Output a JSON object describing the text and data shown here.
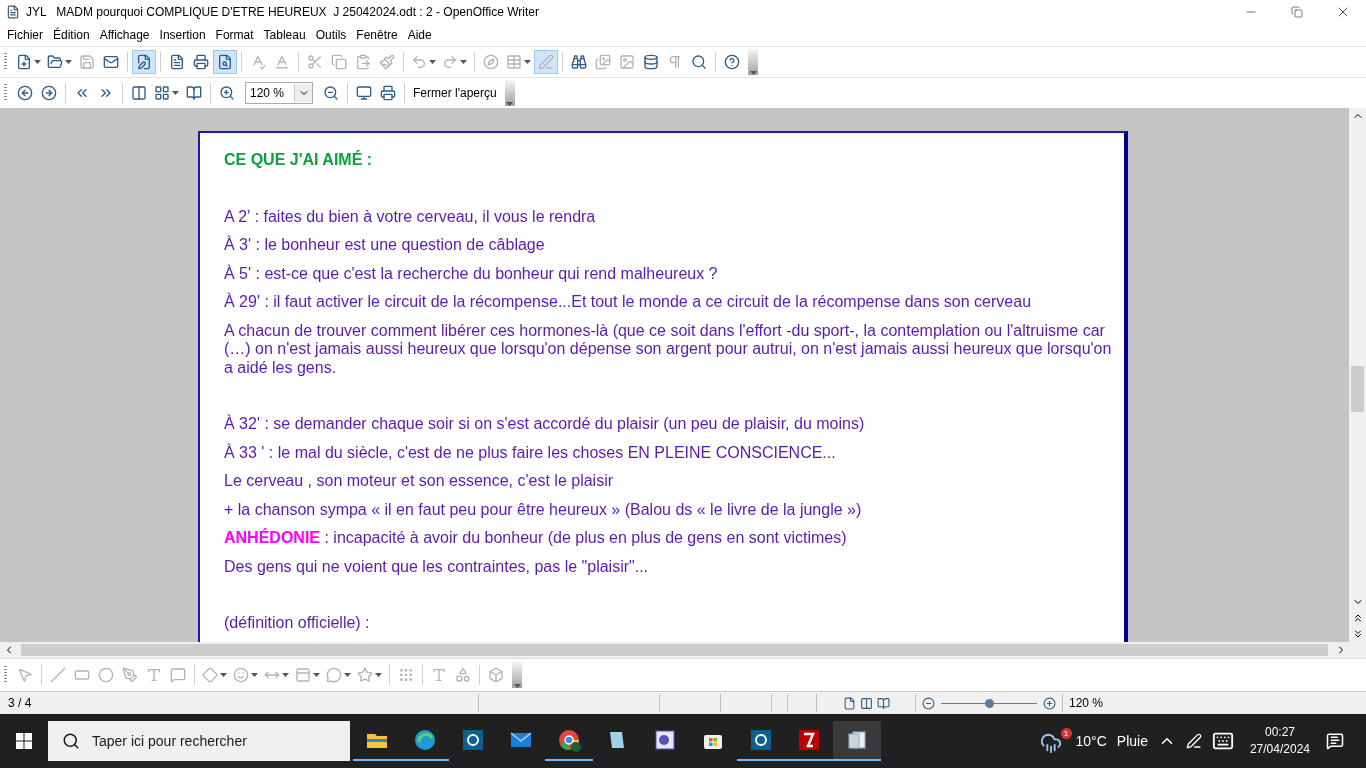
{
  "window": {
    "title": "JYL   MADM pourquoi COMPLIQUE D'ETRE HEUREUX  J 25042024.odt : 2 - OpenOffice Writer"
  },
  "menu": [
    {
      "label": "Fichier",
      "selected": false
    },
    {
      "label": "Édition",
      "selected": false
    },
    {
      "label": "Affichage",
      "selected": false
    },
    {
      "label": "Insertion",
      "selected": false
    },
    {
      "label": "Format",
      "selected": false
    },
    {
      "label": "Tableau",
      "selected": false
    },
    {
      "label": "Outils",
      "selected": false
    },
    {
      "label": "Fenêtre",
      "selected": false
    },
    {
      "label": "Aide",
      "selected": false
    }
  ],
  "standard_toolbar": [
    {
      "kind": "new",
      "disabled": false,
      "pressed": false,
      "dropdown": true
    },
    {
      "kind": "open",
      "disabled": false,
      "pressed": false,
      "dropdown": true
    },
    {
      "kind": "save",
      "disabled": true,
      "pressed": false,
      "dropdown": false
    },
    {
      "kind": "email",
      "disabled": false,
      "pressed": false,
      "dropdown": false
    },
    {
      "kind": "separator"
    },
    {
      "kind": "edit",
      "disabled": false,
      "pressed": true,
      "dropdown": false
    },
    {
      "kind": "separator"
    },
    {
      "kind": "pdf",
      "disabled": false,
      "pressed": false,
      "dropdown": false
    },
    {
      "kind": "print",
      "disabled": false,
      "pressed": false,
      "dropdown": false
    },
    {
      "kind": "preview",
      "disabled": false,
      "pressed": true,
      "dropdown": false
    },
    {
      "kind": "separator"
    },
    {
      "kind": "spellcheck",
      "disabled": true,
      "pressed": false,
      "dropdown": false
    },
    {
      "kind": "autospell",
      "disabled": true,
      "pressed": false,
      "dropdown": false
    },
    {
      "kind": "separator"
    },
    {
      "kind": "cut",
      "disabled": true,
      "pressed": false,
      "dropdown": false
    },
    {
      "kind": "copy",
      "disabled": true,
      "pressed": false,
      "dropdown": false
    },
    {
      "kind": "paste",
      "disabled": true,
      "pressed": false,
      "dropdown": false
    },
    {
      "kind": "brush",
      "disabled": true,
      "pressed": false,
      "dropdown": false
    },
    {
      "kind": "separator"
    },
    {
      "kind": "undo",
      "disabled": true,
      "pressed": false,
      "dropdown": true
    },
    {
      "kind": "redo",
      "disabled": true,
      "pressed": false,
      "dropdown": true
    },
    {
      "kind": "separator"
    },
    {
      "kind": "navigator",
      "disabled": true,
      "pressed": false,
      "dropdown": false
    },
    {
      "kind": "table",
      "disabled": true,
      "pressed": false,
      "dropdown": true
    },
    {
      "kind": "draw",
      "disabled": true,
      "pressed": true,
      "dropdown": false
    },
    {
      "kind": "separator"
    },
    {
      "kind": "find",
      "disabled": false,
      "pressed": false,
      "dropdown": false
    },
    {
      "kind": "gallery",
      "disabled": true,
      "pressed": false,
      "dropdown": false
    },
    {
      "kind": "image",
      "disabled": true,
      "pressed": false,
      "dropdown": false
    },
    {
      "kind": "database",
      "disabled": false,
      "pressed": false,
      "dropdown": false
    },
    {
      "kind": "pilcrow",
      "disabled": true,
      "pressed": false,
      "dropdown": false
    },
    {
      "kind": "zoom",
      "disabled": false,
      "pressed": false,
      "dropdown": false
    },
    {
      "kind": "separator"
    },
    {
      "kind": "help",
      "disabled": false,
      "pressed": false,
      "dropdown": false
    }
  ],
  "preview_toolbar": {
    "items": [
      {
        "kind": "prev",
        "disabled": false,
        "pressed": false,
        "dropdown": false
      },
      {
        "kind": "next",
        "disabled": false,
        "pressed": false,
        "dropdown": false
      },
      {
        "kind": "separator"
      },
      {
        "kind": "first",
        "disabled": false,
        "pressed": false,
        "dropdown": false
      },
      {
        "kind": "last",
        "disabled": false,
        "pressed": false,
        "dropdown": false
      },
      {
        "kind": "separator"
      },
      {
        "kind": "twopage",
        "disabled": false,
        "pressed": false,
        "dropdown": false
      },
      {
        "kind": "multipage",
        "disabled": false,
        "pressed": false,
        "dropdown": true
      },
      {
        "kind": "book",
        "disabled": false,
        "pressed": false,
        "dropdown": false
      },
      {
        "kind": "separator"
      },
      {
        "kind": "zoomin",
        "disabled": false,
        "pressed": false,
        "dropdown": false
      },
      {
        "kind": "zoombox"
      },
      {
        "kind": "zoomout",
        "disabled": false,
        "pressed": false,
        "dropdown": false
      },
      {
        "kind": "separator"
      },
      {
        "kind": "fullscreen",
        "disabled": false,
        "pressed": false,
        "dropdown": false
      },
      {
        "kind": "printoptions",
        "disabled": false,
        "pressed": false,
        "dropdown": false
      },
      {
        "kind": "separator"
      },
      {
        "kind": "close"
      }
    ],
    "zoom_value": "120 %",
    "close_label": "Fermer l'aperçu"
  },
  "document": [
    {
      "paragraphs": [
        {
          "kind": "heading",
          "text": "CE QUE J'AI AIMÉ :"
        }
      ]
    },
    {
      "paragraphs": [
        {
          "kind": "body",
          "text": "A 2' : faites du bien à votre cerveau, il vous le rendra"
        },
        {
          "kind": "body",
          "text": "À 3' : le bonheur est une question de câblage"
        },
        {
          "kind": "body",
          "text": "À 5' : est-ce que c'est la recherche du bonheur qui rend malheureux ?"
        },
        {
          "kind": "body",
          "text": "À 29' : il faut activer le circuit de la récompense...Et tout le monde a ce  circuit de la récompense dans son cerveau"
        },
        {
          "kind": "body",
          "text": "A chacun  de trouver comment libérer ces hormones-là (que ce soit dans l'effort -du sport-, la contemplation ou l'altruisme car (…)  on n'est jamais aussi heureux que lorsqu'on dépense son argent pour autrui, on n'est jamais aussi heureux que lorsqu'on a aidé les gens."
        }
      ]
    },
    {
      "paragraphs": [
        {
          "kind": "body",
          "text": "À 32' : se demander chaque soir si on s'est accordé du plaisir (un peu de plaisir, du moins)"
        },
        {
          "kind": "body",
          "text": "À 33 ' : le mal du siècle, c'est de ne plus faire les choses EN PLEINE CONSCIENCE..."
        },
        {
          "kind": "body",
          "text": "Le cerveau , son moteur et son essence, c'est le plaisir"
        },
        {
          "kind": "body",
          "text": "+ la chanson sympa « il en faut peu pour être heureux »  (Balou ds « le livre de la jungle »)"
        },
        {
          "kind": "term",
          "term": "ANHÉDONIE",
          "text": " : incapacité à avoir du bonheur (de plus en plus de gens en sont victimes)"
        },
        {
          "kind": "body",
          "text": "Des gens qui ne voient que les contraintes, pas le \"plaisir\"..."
        }
      ]
    },
    {
      "paragraphs": [
        {
          "kind": "body",
          "text": "(définition officielle) :"
        }
      ]
    }
  ],
  "drawing_toolbar": [
    {
      "kind": "select",
      "disabled": true,
      "dropdown": false
    },
    {
      "kind": "separator"
    },
    {
      "kind": "line",
      "disabled": true,
      "dropdown": false
    },
    {
      "kind": "rect",
      "disabled": true,
      "dropdown": false
    },
    {
      "kind": "ellipse",
      "disabled": true,
      "dropdown": false
    },
    {
      "kind": "freeform",
      "disabled": true,
      "dropdown": false
    },
    {
      "kind": "text",
      "disabled": true,
      "dropdown": false
    },
    {
      "kind": "callout",
      "disabled": true,
      "dropdown": false
    },
    {
      "kind": "separator"
    },
    {
      "kind": "diamond",
      "disabled": true,
      "dropdown": true
    },
    {
      "kind": "smiley",
      "disabled": true,
      "dropdown": true
    },
    {
      "kind": "arrows",
      "disabled": true,
      "dropdown": true
    },
    {
      "kind": "flowchart",
      "disabled": true,
      "dropdown": true
    },
    {
      "kind": "bubble",
      "disabled": true,
      "dropdown": true
    },
    {
      "kind": "star",
      "disabled": true,
      "dropdown": true
    },
    {
      "kind": "separator"
    },
    {
      "kind": "points",
      "disabled": true,
      "dropdown": false
    },
    {
      "kind": "separator"
    },
    {
      "kind": "fontwork",
      "disabled": true,
      "dropdown": false
    },
    {
      "kind": "extrusion",
      "disabled": true,
      "dropdown": false
    },
    {
      "kind": "separator"
    },
    {
      "kind": "wrap",
      "disabled": true,
      "dropdown": false
    }
  ],
  "status_bar": {
    "page": "3 / 4",
    "zoom_slider": {
      "level": 0.5
    },
    "zoom": "120 %"
  },
  "taskbar": {
    "search_placeholder": "Taper ici pour rechercher",
    "apps": [
      {
        "kind": "explorer",
        "running": true,
        "selected": false
      },
      {
        "kind": "edge",
        "running": true,
        "selected": false
      },
      {
        "kind": "bluebox",
        "running": false,
        "selected": false
      },
      {
        "kind": "mail",
        "running": false,
        "selected": false
      },
      {
        "kind": "chrome",
        "running": true,
        "selected": false
      },
      {
        "kind": "notepad",
        "running": false,
        "selected": false
      },
      {
        "kind": "purplebox",
        "running": false,
        "selected": false
      },
      {
        "kind": "store",
        "running": false,
        "selected": false
      },
      {
        "kind": "bluebox",
        "running": true,
        "selected": false
      },
      {
        "kind": "filezilla",
        "running": true,
        "selected": false
      },
      {
        "kind": "writer",
        "running": true,
        "selected": true
      }
    ],
    "weather_badge": "1",
    "temperature": "10°C",
    "weather": "Pluie",
    "time": "00:27",
    "date": "27/04/2024"
  }
}
